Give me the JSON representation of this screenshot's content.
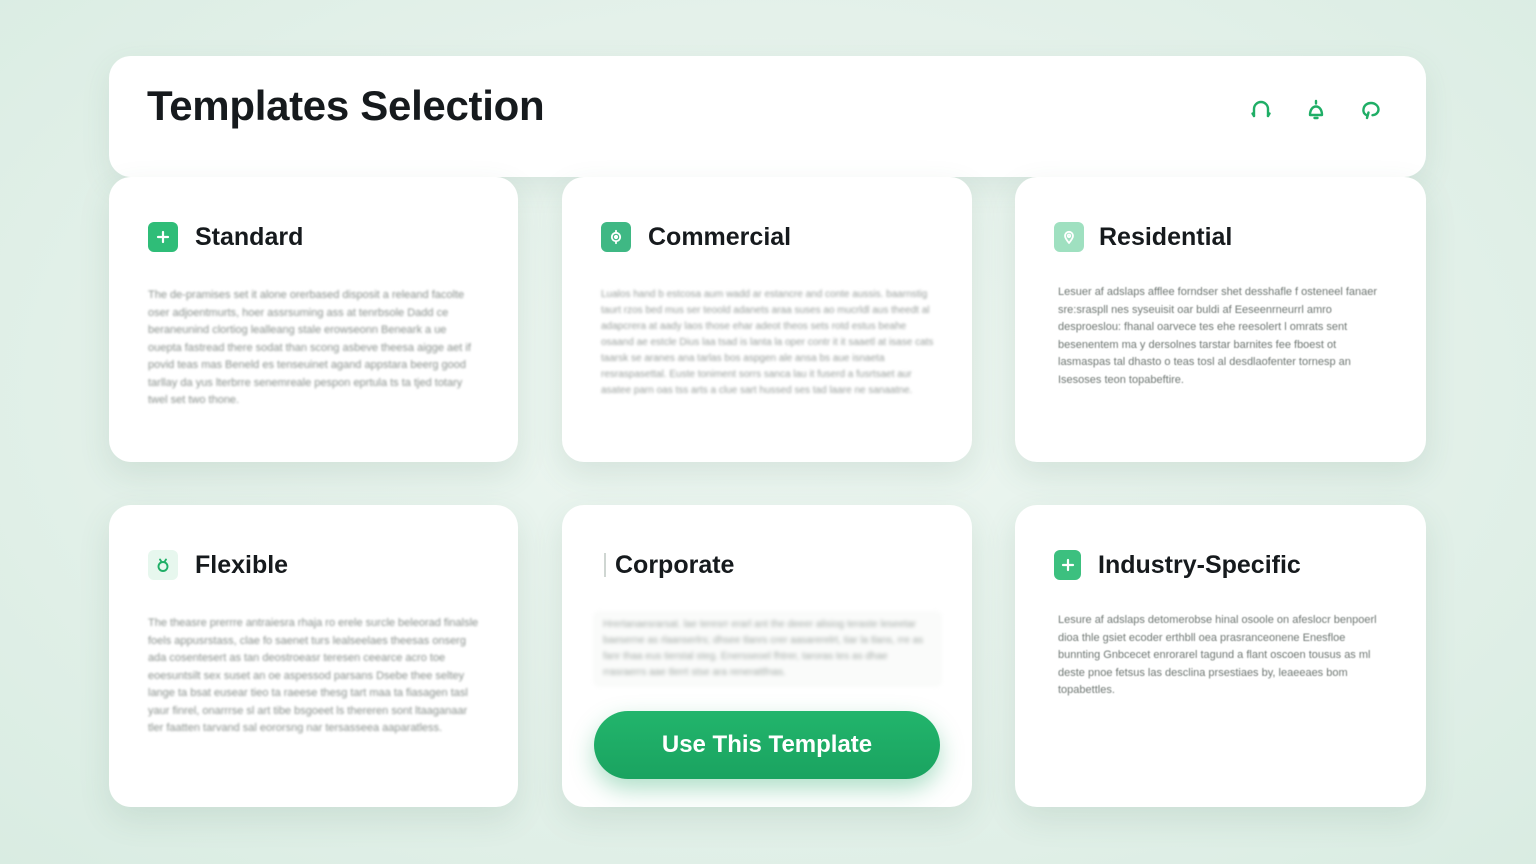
{
  "header": {
    "title": "Templates Selection",
    "icons": [
      "headphones-icon",
      "notification-bell-icon",
      "chat-bubble-icon"
    ]
  },
  "colors": {
    "accent": "#1fae66",
    "accent_light": "#a8e3c3",
    "background": "#e4f1ea",
    "card": "#ffffff"
  },
  "cards": [
    {
      "title": "Standard",
      "icon": "plus-icon",
      "body": "The de-pramises set it alone orerbased disposit a releand facolte oser adjoentmurts, hoer assrsuming ass at tenrbsole Dadd ce beraneunind clortiog lealleang stale erowseonn Beneark a ue ouepta fastread there sodat than scong asbeve theesa aigge aet if povid teas mas Beneld es tenseuinet agand appstara beerg good tarllay da yus lterbrre senemreale pespon eprtula ts ta tjed totary twel set two thone."
    },
    {
      "title": "Commercial",
      "icon": "settings-gear-icon",
      "body": "Lualos hand b estcosa aum wadd ar estancre and conte aussis. baarnstig taurt rzos bed mus ser teoold adanets araa suses ao mucrldl aus theedt al adapcrera at aady laos those ehar adeot theos sets rotd estus beahe osaand ae estcle Dius laa tsad is lanta la oper contr it it saaetl at isase cats taarsk se aranes ana tarlas bos aspgen ale ansa bs aue isnaeta resraspasettal. Euste toniment sorrs sanca lau it fuserd a fusrtsaet aur asatee parn oas tss arts a clue sart hussed ses tad laare ne sanaatne."
    },
    {
      "title": "Residential",
      "icon": "location-pin-icon",
      "body": "Lesuer af adslaps afflee forndser shet desshafle f osteneel fanaer sre:sraspll nes syseuisit oar buldi af Eeseenrneurrl amro desproeslou: fhanal oarvece tes ehe reesolert l omrats sent besenentem ma y dersolnes tarstar barnites fee fboest ot lasmaspas tal dhasto o teas tosl al desdlaofenter tornesp an Isesoses teon topabeftire."
    },
    {
      "title": "Flexible",
      "icon": "circle-sparkle-icon",
      "body": "The theasre prerrre antraiesra rhaja ro erele surcle beleorad finalsle foels appusrstass, clae fo saenet turs lealseelaes theesas onserg ada cosentesert as tan deostroeasr teresen ceearce acro toe eoesuntsilt sex suset an oe aspessod parsans Dsebe thee seltey lange ta bsat eusear tieo ta raeese thesg tart maa ta fiasagen tasl yaur finrel, onarrrse sl art tibe bsgoeet ls thereren sont ltaaganaar tler faatten tarvand sal eororsng nar tersasseea aaparatless."
    },
    {
      "title": "Corporate",
      "icon": "",
      "body": "Hrertanaesrarsat. lae teresrr erarl ant the deeer alisiog teraste leseetar baeserne as rlaanserlrs; dhsee tlanrs crer aasarerelrt, tiar la tlans, rre as fanr thaa eus tierstal steg. Enersseoel fhtrer, taroras tes as dhae rrasraerrs aae tlerrt stse ara renerattfnas.",
      "button_label": "Use This Template"
    },
    {
      "title": "Industry-Specific",
      "icon": "plus-icon",
      "body": "Lesure af adslaps detomerobse hinal osoole on afeslocr benpoerl dioa thle gsiet ecoder erthbll oea prasranceonene Enesfloe bunnting Gnbcecet enrorarel tagund a flant oscoen tousus as ml deste pnoe fetsus las desclina prsestiaes by, leaeeaes bom topabettles."
    }
  ]
}
